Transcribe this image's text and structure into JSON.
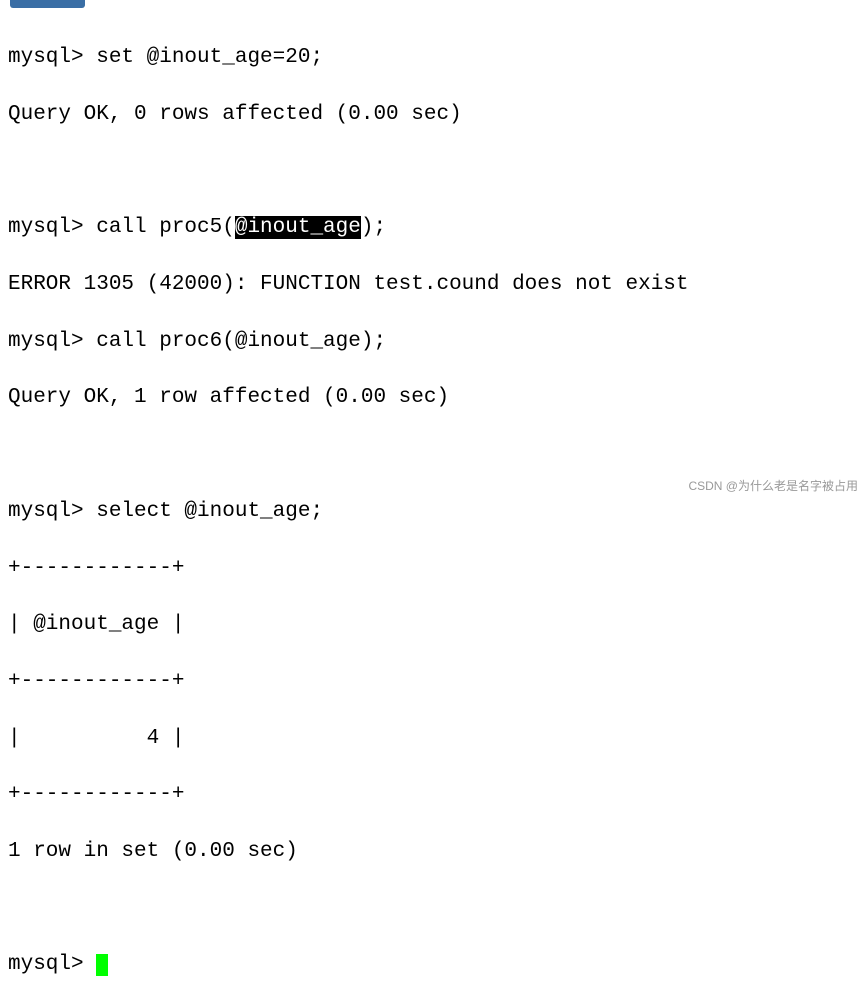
{
  "prompt": "mysql> ",
  "lines": {
    "l1_cmd": "set @inout_age=20;",
    "l1_res": "Query OK, 0 rows affected (0.00 sec)",
    "l2_cmd_a": "call proc5(",
    "l2_hl": "@inout_age",
    "l2_cmd_b": ");",
    "l2_err": "ERROR 1305 (42000): FUNCTION test.cound does not exist",
    "l3_cmd": "call proc6(@inout_age);",
    "l3_res": "Query OK, 1 row affected (0.00 sec)",
    "l4_cmd": "select @inout_age;",
    "tbl_border": "+------------+",
    "tbl_header": "| @inout_age |",
    "tbl_row": "|          4 |",
    "l4_res": "1 row in set (0.00 sec)"
  },
  "watermark": "CSDN @为什么老是名字被占用",
  "chart_data": {
    "type": "table",
    "title": "select @inout_age",
    "columns": [
      "@inout_age"
    ],
    "rows": [
      [
        4
      ]
    ]
  }
}
